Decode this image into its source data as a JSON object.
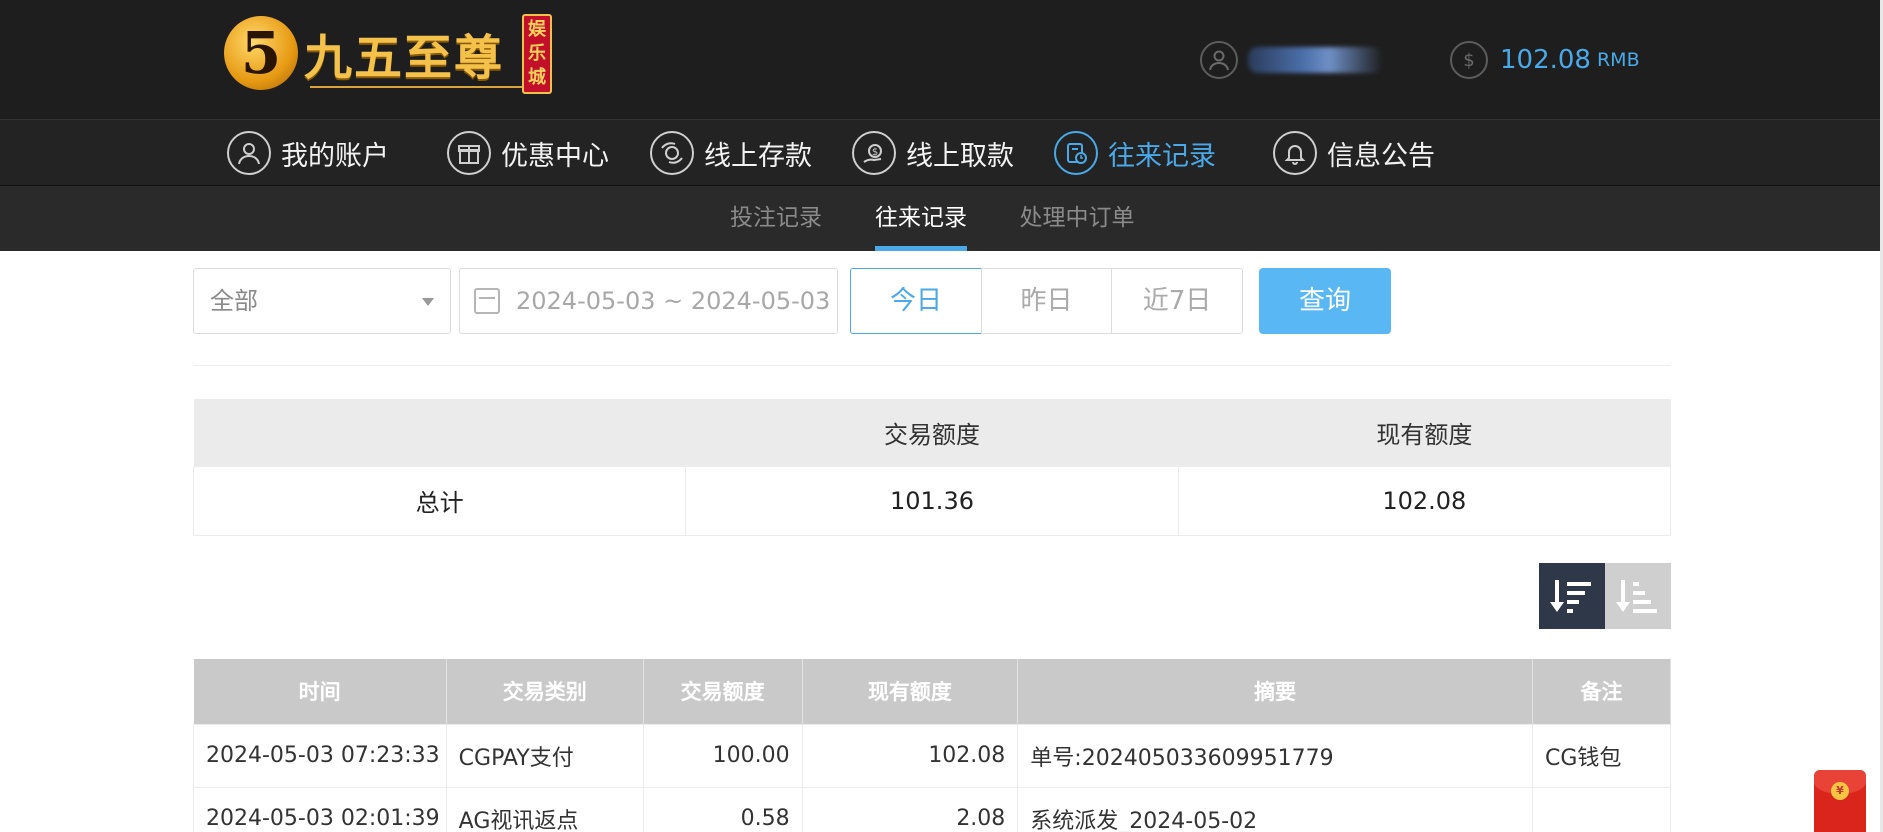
{
  "brand": {
    "numeral": "5",
    "name": "九五至尊",
    "badge": [
      "娱",
      "乐",
      "城"
    ]
  },
  "account": {
    "balance": "102.08",
    "currency": "RMB",
    "user_icon": "user-icon",
    "money_icon": "dollar-icon"
  },
  "nav": [
    {
      "label": "我的账户",
      "icon": "user-icon",
      "active": false
    },
    {
      "label": "优惠中心",
      "icon": "gift-icon",
      "active": false
    },
    {
      "label": "线上存款",
      "icon": "deposit-icon",
      "active": false
    },
    {
      "label": "线上取款",
      "icon": "withdraw-icon",
      "active": false
    },
    {
      "label": "往来记录",
      "icon": "records-icon",
      "active": true
    },
    {
      "label": "信息公告",
      "icon": "bell-icon",
      "active": false
    }
  ],
  "subnav": [
    {
      "label": "投注记录",
      "active": false
    },
    {
      "label": "往来记录",
      "active": true
    },
    {
      "label": "处理中订单",
      "active": false
    }
  ],
  "filters": {
    "type_selected": "全部",
    "date_range": "2024-05-03 ~ 2024-05-03",
    "quick": [
      "今日",
      "昨日",
      "近7日"
    ],
    "quick_active": "今日",
    "query_label": "查询"
  },
  "summary": {
    "headers": [
      "",
      "交易额度",
      "现有额度"
    ],
    "row": [
      "总计",
      "101.36",
      "102.08"
    ]
  },
  "records": {
    "headers": [
      "时间",
      "交易类别",
      "交易额度",
      "现有额度",
      "摘要",
      "备注"
    ],
    "rows": [
      [
        "2024-05-03 07:23:33",
        "CGPAY支付",
        "100.00",
        "102.08",
        "单号:202405033609951779",
        "CG钱包"
      ],
      [
        "2024-05-03 02:01:39",
        "AG视讯返点",
        "0.58",
        "2.08",
        "系统派发_2024-05-02",
        ""
      ]
    ]
  },
  "colors": {
    "accent": "#4aa9e8",
    "header_bg": "#1e1e1e",
    "nav_bg": "#232323",
    "query_button": "#59b8f4"
  }
}
